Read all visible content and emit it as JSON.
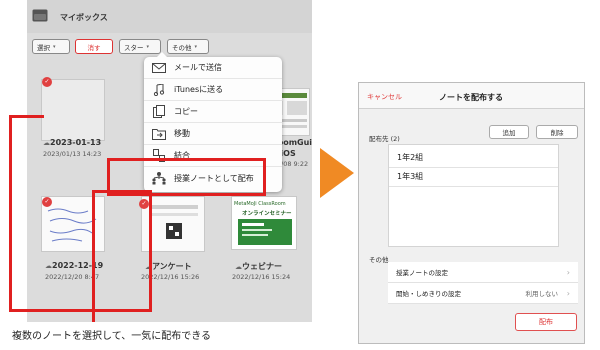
{
  "header": {
    "title": "マイボックス"
  },
  "toolbar": {
    "select_label": "選択",
    "delete_label": "消す",
    "star_label": "スター",
    "other_label": "その他"
  },
  "notes": [
    {
      "title": "2023-01-13",
      "date": "2023/01/13 14:23",
      "checked": true
    },
    {
      "title": "ClassRoomGuide_iOS",
      "title_line1": "ClassRoomGuid",
      "title_line2": "e_iOS",
      "date": "/08 9:22",
      "checked": false
    },
    {
      "title": "2022-12-19",
      "date": "2022/12/20 8:47",
      "checked": true
    },
    {
      "title": "アンケート",
      "date": "2022/12/16 15:26",
      "checked": true
    },
    {
      "title": "ウェビナー",
      "date": "2022/12/16 15:24",
      "checked": false
    }
  ],
  "thumb_text": {
    "webinar_line1": "MetaMoJi ClassRoom",
    "webinar_line2": "オンラインセミナー"
  },
  "context_menu": {
    "items": [
      {
        "label": "メールで送信",
        "icon": "mail-icon"
      },
      {
        "label": "iTunesに送る",
        "icon": "music-note-icon"
      },
      {
        "label": "コピー",
        "icon": "copy-icon"
      },
      {
        "label": "移動",
        "icon": "move-icon"
      },
      {
        "label": "結合",
        "icon": "merge-icon"
      },
      {
        "label": "授業ノートとして配布",
        "icon": "distribute-icon"
      }
    ]
  },
  "dialog": {
    "cancel_label": "キャンセル",
    "title": "ノートを配布する",
    "recipients_label": "配布先 (2)",
    "add_label": "追加",
    "remove_label": "削除",
    "recipients": [
      "1年2組",
      "1年3組"
    ],
    "other_label": "その他",
    "rows": [
      {
        "label": "授業ノートの設定",
        "value": ""
      },
      {
        "label": "開始・しめきりの設定",
        "value": "利用しない"
      }
    ],
    "distribute_label": "配布"
  },
  "caption": "複数のノートを選択して、一気に配布できる",
  "colors": {
    "accent_red": "#e02020",
    "arrow_orange": "#f08a24"
  }
}
